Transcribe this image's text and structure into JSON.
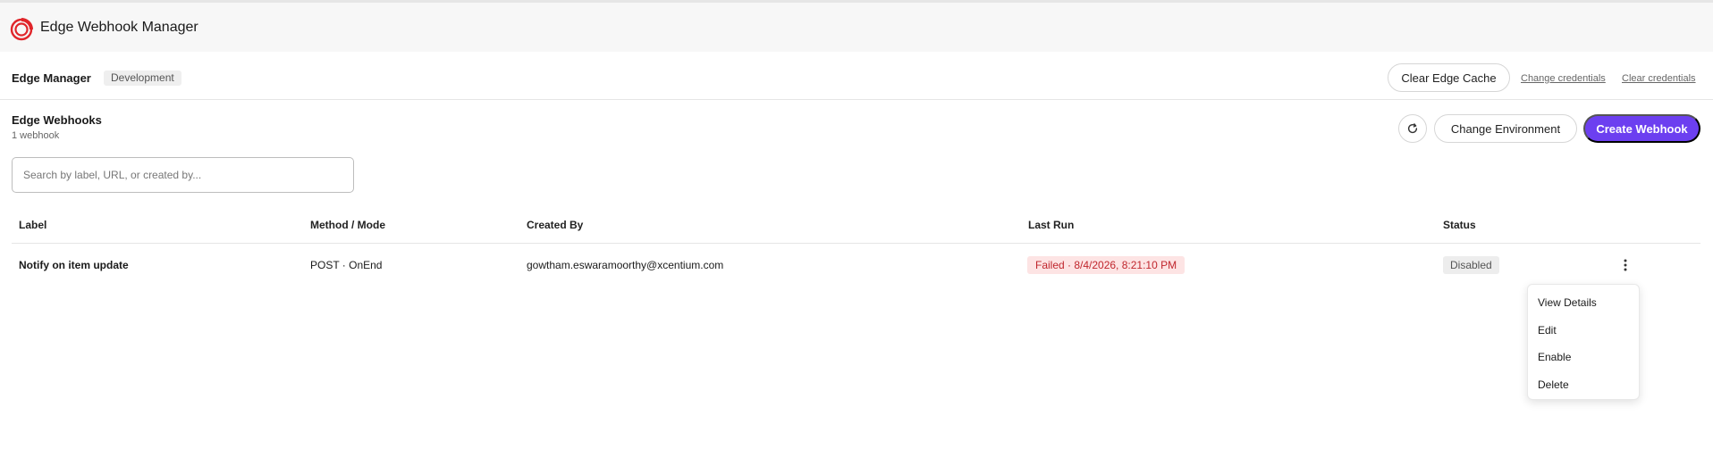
{
  "app": {
    "title": "Edge Webhook Manager",
    "brand_color": "#e0252a"
  },
  "subbar": {
    "title": "Edge Manager",
    "environment": "Development",
    "clear_cache_label": "Clear Edge Cache",
    "change_credentials_label": "Change credentials",
    "clear_credentials_label": "Clear credentials"
  },
  "section": {
    "title": "Edge Webhooks",
    "count_text": "1 webhook",
    "refresh_icon": "refresh-icon",
    "change_env_label": "Change Environment",
    "create_label": "Create Webhook",
    "accent": "#6c3ff0"
  },
  "search": {
    "placeholder": "Search by label, URL, or created by...",
    "value": ""
  },
  "table": {
    "columns": [
      "Label",
      "Method / Mode",
      "Created By",
      "Last Run",
      "Status"
    ],
    "rows": [
      {
        "label": "Notify on item update",
        "method_mode": "POST · OnEnd",
        "created_by": "gowtham.eswaramoorthy@xcentium.com",
        "last_run": "Failed · 8/4/2026, 8:21:10 PM",
        "status": "Disabled"
      }
    ]
  },
  "row_menu": {
    "items": [
      "View Details",
      "Edit",
      "Enable",
      "Delete"
    ]
  }
}
